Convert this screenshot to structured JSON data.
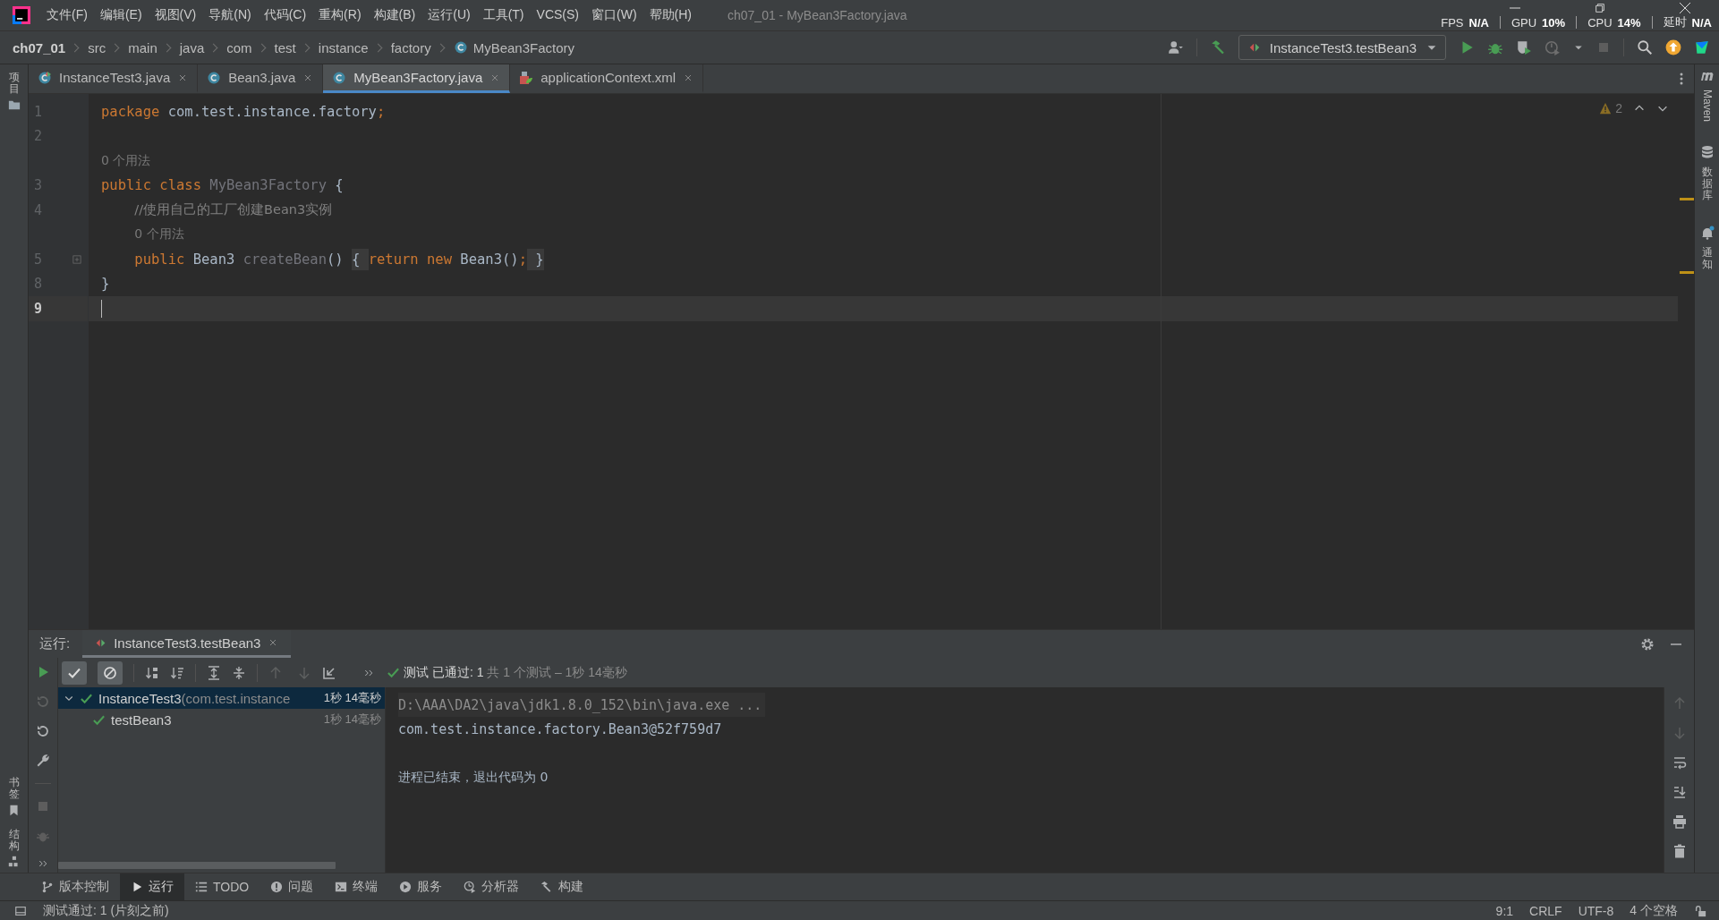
{
  "window": {
    "title": "ch07_01 - MyBean3Factory.java"
  },
  "menu": [
    "文件(F)",
    "编辑(E)",
    "视图(V)",
    "导航(N)",
    "代码(C)",
    "重构(R)",
    "构建(B)",
    "运行(U)",
    "工具(T)",
    "VCS(S)",
    "窗口(W)",
    "帮助(H)"
  ],
  "perf_overlay": [
    {
      "label": "FPS",
      "value": "N/A"
    },
    {
      "label": "GPU",
      "value": "10%"
    },
    {
      "label": "CPU",
      "value": "14%"
    },
    {
      "label": "延时",
      "value": "N/A"
    }
  ],
  "breadcrumbs": [
    {
      "label": "ch07_01",
      "kind": "project"
    },
    {
      "label": "src",
      "kind": "folder"
    },
    {
      "label": "main",
      "kind": "folder"
    },
    {
      "label": "java",
      "kind": "folder"
    },
    {
      "label": "com",
      "kind": "folder"
    },
    {
      "label": "test",
      "kind": "folder"
    },
    {
      "label": "instance",
      "kind": "folder"
    },
    {
      "label": "factory",
      "kind": "folder"
    },
    {
      "label": "MyBean3Factory",
      "kind": "class"
    }
  ],
  "run_configuration": {
    "label": "InstanceTest3.testBean3"
  },
  "left_strip": {
    "top": [
      {
        "label": "项目"
      }
    ],
    "bottom": [
      {
        "label": "书签",
        "kind": "bookmark"
      },
      {
        "label": "结构",
        "kind": "structure"
      }
    ]
  },
  "right_strip": [
    {
      "label": "Maven",
      "kind": "maven",
      "unread": false
    },
    {
      "label": "数据库",
      "kind": "database",
      "unread": false
    },
    {
      "label": "通知",
      "kind": "notifications",
      "unread": true
    }
  ],
  "editor_tabs": [
    {
      "label": "InstanceTest3.java",
      "kind": "test-class",
      "selected": false
    },
    {
      "label": "Bean3.java",
      "kind": "class",
      "selected": false
    },
    {
      "label": "MyBean3Factory.java",
      "kind": "class",
      "selected": true
    },
    {
      "label": "applicationContext.xml",
      "kind": "xml",
      "selected": false
    }
  ],
  "editor": {
    "warnings": "2",
    "lines": [
      {
        "number": "1",
        "current": false,
        "folded": false,
        "tokens": [
          {
            "text": "package",
            "kind": "keyword"
          },
          {
            "text": " com.test.instance.factory",
            "kind": "plain"
          },
          {
            "text": ";",
            "kind": "keyword"
          }
        ]
      },
      {
        "number": "2",
        "current": false,
        "folded": false
      },
      {
        "number": "3",
        "usage_hint": "0 个用法",
        "current": false,
        "folded": false,
        "tokens": [
          {
            "text": "public class ",
            "kind": "keyword"
          },
          {
            "text": "MyBean3Factory",
            "kind": "unused"
          },
          {
            "text": " {",
            "kind": "plain"
          }
        ]
      },
      {
        "number": "4",
        "current": false,
        "folded": false,
        "tokens": [
          {
            "text": "    //使用自己的工厂创建Bean3实例",
            "kind": "comment"
          }
        ]
      },
      {
        "number": "5",
        "usage_hint": "0 个用法",
        "current": false,
        "folded": true,
        "tokens": [
          {
            "text": "    public ",
            "kind": "keyword"
          },
          {
            "text": "Bean3 ",
            "kind": "plain"
          },
          {
            "text": "createBean",
            "kind": "unused"
          },
          {
            "text": "() ",
            "kind": "plain"
          },
          {
            "text": "{ ",
            "kind": "fold"
          },
          {
            "text": "return new ",
            "kind": "keyword"
          },
          {
            "text": "Bean3()",
            "kind": "plain"
          },
          {
            "text": ";",
            "kind": "keyword"
          },
          {
            "text": " }",
            "kind": "fold"
          }
        ]
      },
      {
        "number": "8",
        "current": false,
        "folded": false,
        "tokens": [
          {
            "text": "}",
            "kind": "plain"
          }
        ]
      },
      {
        "number": "9",
        "current": true,
        "folded": false
      }
    ]
  },
  "run_panel": {
    "label": "运行:",
    "tab": {
      "label": "InstanceTest3.testBean3",
      "selected": true
    },
    "toolbar": {
      "show_passed": {
        "on": true
      },
      "show_ignored": {
        "on": true
      },
      "navigation": {
        "disabled": true
      }
    },
    "status": {
      "result": "测试 已通过: 1",
      "detail": "共 1 个测试 – 1秒 14毫秒"
    },
    "tree": [
      {
        "name": "InstanceTest3",
        "detail": "(com.test.instance",
        "time": "1秒 14毫秒",
        "passed": true,
        "selected": true,
        "expanded": true,
        "children": [
          {
            "name": "testBean3",
            "time": "1秒 14毫秒",
            "passed": true,
            "selected": false
          }
        ]
      }
    ],
    "console": [
      {
        "text": "D:\\AAA\\DA2\\java\\jdk1.8.0_152\\bin\\java.exe ...",
        "kind": "command"
      },
      {
        "text": "com.test.instance.factory.Bean3@52f759d7",
        "kind": "output"
      },
      {
        "text": "进程已结束，退出代码为 0",
        "kind": "system"
      }
    ]
  },
  "tool_windows": [
    {
      "label": "版本控制",
      "kind": "vcs",
      "selected": false
    },
    {
      "label": "运行",
      "kind": "run",
      "selected": true
    },
    {
      "label": "TODO",
      "kind": "todo",
      "selected": false
    },
    {
      "label": "问题",
      "kind": "problems",
      "selected": false
    },
    {
      "label": "终端",
      "kind": "terminal",
      "selected": false
    },
    {
      "label": "服务",
      "kind": "services",
      "selected": false
    },
    {
      "label": "分析器",
      "kind": "profiler",
      "selected": false
    },
    {
      "label": "构建",
      "kind": "build",
      "selected": false
    }
  ],
  "status_bar": {
    "message": "测试通过: 1 (片刻之前)",
    "position": "9:1",
    "line_separator": "CRLF",
    "encoding": "UTF-8",
    "indent": "4 个空格"
  }
}
